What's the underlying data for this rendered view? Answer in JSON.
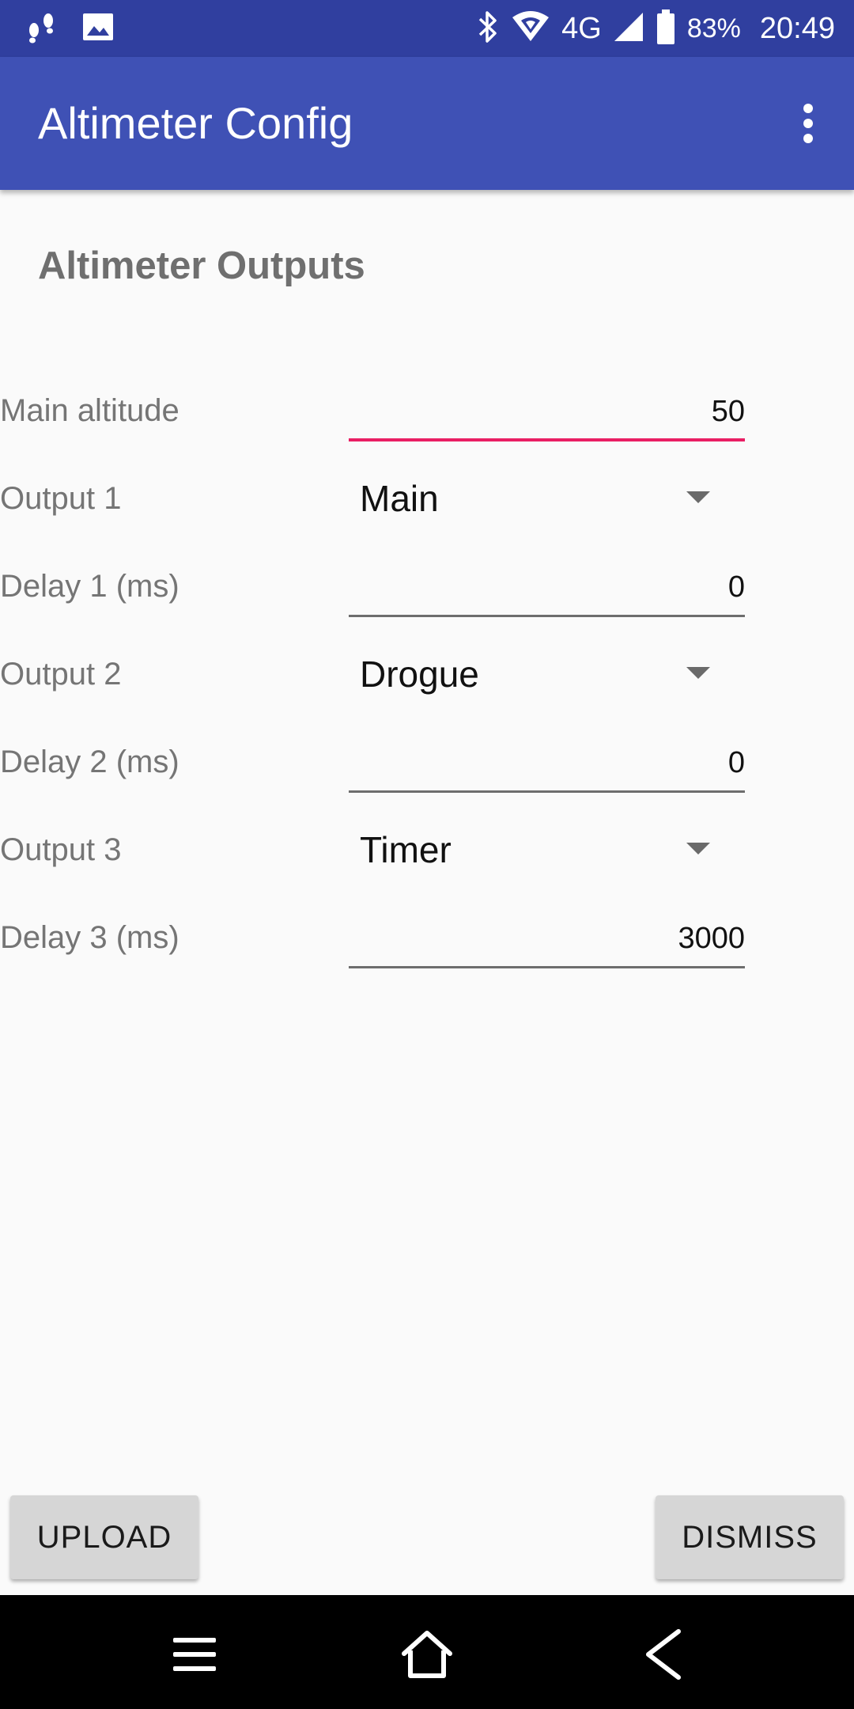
{
  "status_bar": {
    "left_icons": [
      "footsteps-icon",
      "image-icon"
    ],
    "right_icons": [
      "bluetooth-icon",
      "wifi-icon",
      "cell-signal-icon",
      "battery-icon"
    ],
    "network": "4G",
    "battery": "83%",
    "time": "20:49"
  },
  "app_bar": {
    "title": "Altimeter Config",
    "menu_icon": "overflow-menu-icon"
  },
  "content": {
    "section_title": "Altimeter Outputs",
    "rows": [
      {
        "label": "Main altitude",
        "type": "input",
        "value": "50",
        "focused": true
      },
      {
        "label": "Output 1",
        "type": "select",
        "value": "Main"
      },
      {
        "label": "Delay 1 (ms)",
        "type": "input",
        "value": "0"
      },
      {
        "label": "Output 2",
        "type": "select",
        "value": "Drogue"
      },
      {
        "label": "Delay 2 (ms)",
        "type": "input",
        "value": "0"
      },
      {
        "label": "Output 3",
        "type": "select",
        "value": "Timer"
      },
      {
        "label": "Delay 3 (ms)",
        "type": "input",
        "value": "3000"
      }
    ]
  },
  "buttons": {
    "upload": "UPLOAD",
    "dismiss": "DISMISS"
  },
  "nav_bar": {
    "icons": [
      "menu-icon",
      "home-icon",
      "back-icon"
    ]
  },
  "colors": {
    "status_bar": "#303f9f",
    "app_bar": "#3f51b5",
    "focus_accent": "#e91e63",
    "background": "#fafafa"
  }
}
